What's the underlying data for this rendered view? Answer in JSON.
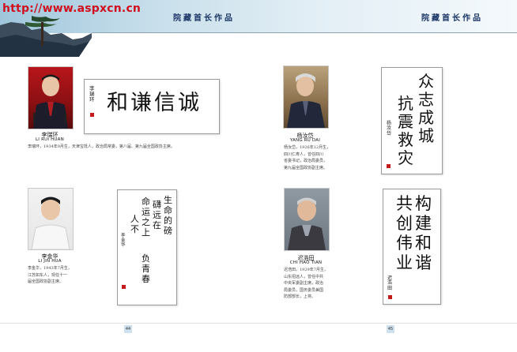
{
  "header": {
    "site_url": "http://www.aspxcn.cn",
    "title_left": "院藏首长作品",
    "title_right": "院藏首长作品"
  },
  "entries": [
    {
      "name": "李瑞环",
      "pinyin": "LI RUI HUAN",
      "bio": [
        "李瑞环，1934年9月生，天津宝坻人，政治局常委，第八届、第九届全国政协主席。"
      ],
      "calligraphy": "和谦信诚",
      "inscription": "李瑞环"
    },
    {
      "name": "杨汝岱",
      "pinyin": "YANG RU DAI",
      "bio": [
        "杨汝岱，1926年12月生，",
        "四川仁寿人，曾任四川",
        "省委书记，政治局委员，",
        "第九届全国政协副主席。"
      ],
      "calligraphy_cols": [
        "众志成城",
        "抗震救灾"
      ],
      "inscription": "杨汝岱"
    },
    {
      "name": "李金华",
      "pinyin": "LI JIN HUA",
      "bio": [
        "李金华，1943年7月生，",
        "江苏如东人，现任十一",
        "届全国政协副主席。"
      ],
      "calligraphy_cols": [
        "生命的磅",
        "礴远在",
        "命运之上",
        "人不",
        "负青春"
      ],
      "inscription": "李金华"
    },
    {
      "name": "迟浩田",
      "pinyin": "CHI HAO TIAN",
      "bio": [
        "迟浩田，1929年7月生，",
        "山东招远人，曾任中共",
        "中央军委副主席，政治",
        "局委员，国务委员兼国",
        "防部部长，上将。"
      ],
      "calligraphy_cols": [
        "构建和谐",
        "共创伟业"
      ],
      "inscription": "迟浩田"
    }
  ],
  "footer": {
    "page_left": "44",
    "page_right": "45"
  },
  "colors": {
    "url_red": "#d0101e",
    "header_blue": "#1b3566",
    "seal_red": "#c51a1a"
  }
}
